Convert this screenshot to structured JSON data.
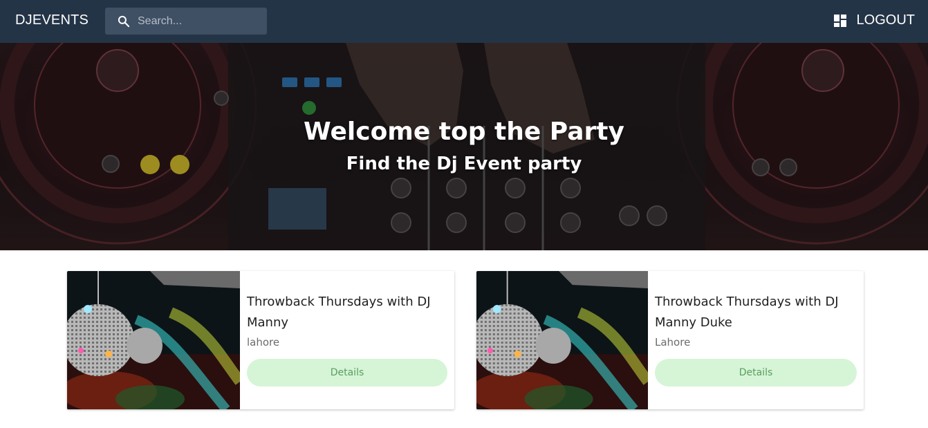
{
  "header": {
    "brand": "DJEVENTS",
    "search_placeholder": "Search...",
    "search_icon": "search-icon",
    "logout_icon": "dashboard-icon",
    "logout_label": "LOGOUT",
    "background_color": "#243447"
  },
  "hero": {
    "title": "Welcome top the Party",
    "subtitle": "Find the Dj Event party"
  },
  "events": [
    {
      "title": "Throwback Thursdays with DJ Manny",
      "location": "lahore",
      "button_label": "Details"
    },
    {
      "title": "Throwback Thursdays with DJ Manny Duke",
      "location": "Lahore",
      "button_label": "Details"
    }
  ],
  "colors": {
    "details_button_bg": "#d5f5d6",
    "details_button_text": "#5a9e5e"
  }
}
